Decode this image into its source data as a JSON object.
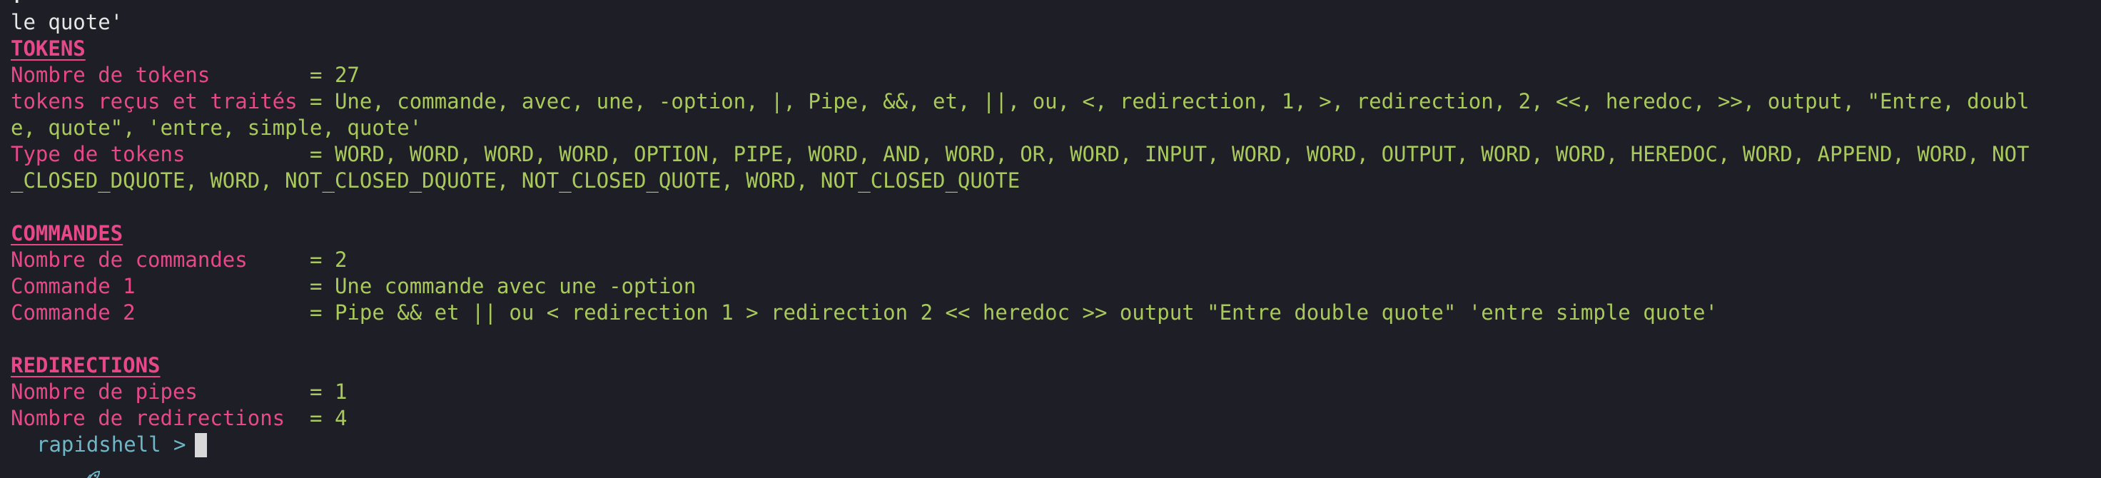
{
  "top_lines": [
    ".",
    "le quote'"
  ],
  "tokens": {
    "header": "TOKENS",
    "nb_label": "Nombre de tokens       ",
    "nb_value": "27",
    "recus_label": "tokens reçus et traités",
    "recus_line1": "Une, commande, avec, une, -option, |, Pipe, &&, et, ||, ou, <, redirection, 1, >, redirection, 2, <<, heredoc, >>, output, \"Entre, doubl",
    "recus_line2": "e, quote\", 'entre, simple, quote'",
    "type_label": "Type de tokens         ",
    "type_line1": "WORD, WORD, WORD, WORD, OPTION, PIPE, WORD, AND, WORD, OR, WORD, INPUT, WORD, WORD, OUTPUT, WORD, WORD, HEREDOC, WORD, APPEND, WORD, NOT",
    "type_line2": "_CLOSED_DQUOTE, WORD, NOT_CLOSED_DQUOTE, NOT_CLOSED_QUOTE, WORD, NOT_CLOSED_QUOTE"
  },
  "commandes": {
    "header": "COMMANDES",
    "nb_label": "Nombre de commandes    ",
    "nb_value": "2",
    "cmd1_label": "Commande 1             ",
    "cmd1_value": "Une commande avec une -option",
    "cmd2_label": "Commande 2             ",
    "cmd2_value": "Pipe && et || ou < redirection 1 > redirection 2 << heredoc >> output \"Entre double quote\" 'entre simple quote'"
  },
  "redirections": {
    "header": "REDIRECTIONS",
    "pipes_label": "Nombre de pipes        ",
    "pipes_value": "1",
    "redir_label": "Nombre de redirections ",
    "redir_value": "4"
  },
  "prompt": {
    "icon": "rocket-icon",
    "text": "rapidshell >"
  },
  "colors": {
    "background": "#1e1f26",
    "label": "#e8488a",
    "value": "#a9c95b",
    "prompt": "#6fb6c6"
  }
}
